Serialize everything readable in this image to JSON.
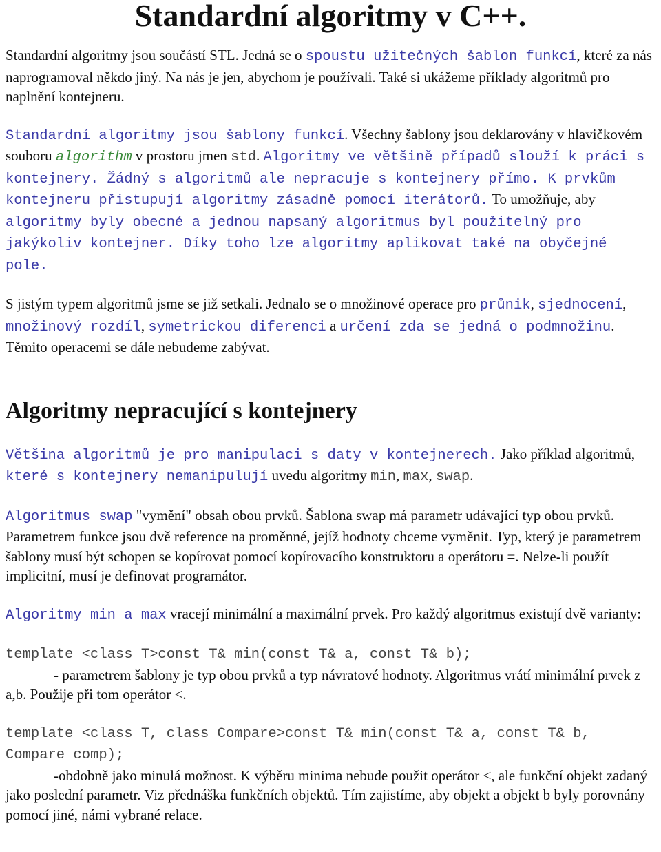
{
  "title": "Standardní algoritmy v C++.",
  "heading2": "Algoritmy nepracující s kontejnery",
  "paragraphs": [
    {
      "id": "intro",
      "cls": "",
      "segs": [
        {
          "t": "Standardní algoritmy jsou součástí STL. Jedná se o ",
          "s": "text"
        },
        {
          "t": "spoustu užitečných šablon funkcí",
          "s": "blue"
        },
        {
          "t": ", které za nás naprogramoval někdo jiný. Na nás je jen, abychom je používali. Také si ukážeme příklady algoritmů pro naplnění kontejneru.",
          "s": "text"
        }
      ]
    },
    {
      "id": "templates",
      "cls": "",
      "segs": [
        {
          "t": "Standardní algoritmy jsou šablony funkcí",
          "s": "blue"
        },
        {
          "t": ". Všechny šablony jsou deklarovány v hlavičkovém souboru ",
          "s": "text"
        },
        {
          "t": "algorithm",
          "s": "green"
        },
        {
          "t": " v prostoru jmen ",
          "s": "text"
        },
        {
          "t": "std",
          "s": "gray"
        },
        {
          "t": ". ",
          "s": "text"
        },
        {
          "t": "Algoritmy ve většině případů slouží k práci s kontejnery. Žádný s algoritmů ale nepracuje s kontejnery přímo. K prvkům kontejneru přistupují algoritmy zásadně pomocí iterátorů.",
          "s": "blue"
        },
        {
          "t": " To umožňuje, aby ",
          "s": "text"
        },
        {
          "t": "algoritmy byly obecné a jednou napsaný algoritmus byl použitelný pro jakýkoliv kontejner. Díky toho lze algoritmy aplikovat také na obyčejné pole.",
          "s": "blue"
        }
      ]
    },
    {
      "id": "sets",
      "cls": "",
      "segs": [
        {
          "t": "S jistým typem algoritmů jsme se již setkali. Jednalo se o množinové operace pro ",
          "s": "text"
        },
        {
          "t": "průnik",
          "s": "blue"
        },
        {
          "t": ", ",
          "s": "text"
        },
        {
          "t": "sjednocení",
          "s": "blue"
        },
        {
          "t": ", ",
          "s": "text"
        },
        {
          "t": "množinový rozdíl",
          "s": "blue"
        },
        {
          "t": ", ",
          "s": "text"
        },
        {
          "t": "symetrickou diferenci",
          "s": "blue"
        },
        {
          "t": " a ",
          "s": "text"
        },
        {
          "t": "určení zda se jedná o podmnožinu",
          "s": "blue"
        },
        {
          "t": ". Těmito operacemi se dále nebudeme zabývat.",
          "s": "text"
        }
      ]
    },
    {
      "id": "h2",
      "heading": true
    },
    {
      "id": "most",
      "cls": "",
      "segs": [
        {
          "t": "Většina algoritmů je pro manipulaci s daty v kontejnerech.",
          "s": "blue"
        },
        {
          "t": " Jako příklad algoritmů, ",
          "s": "text"
        },
        {
          "t": "které s kontejnery nemanipulují",
          "s": "blue"
        },
        {
          "t": " uvedu algoritmy ",
          "s": "text"
        },
        {
          "t": "min",
          "s": "gray"
        },
        {
          "t": ", ",
          "s": "text"
        },
        {
          "t": "max",
          "s": "gray"
        },
        {
          "t": ", ",
          "s": "text"
        },
        {
          "t": "swap",
          "s": "gray"
        },
        {
          "t": ".",
          "s": "text"
        }
      ]
    },
    {
      "id": "swap",
      "cls": "",
      "segs": [
        {
          "t": "Algoritmus swap",
          "s": "blue"
        },
        {
          "t": " \"vymění\" obsah obou prvků. Šablona swap má parametr udávající typ obou prvků. Parametrem funkce jsou dvě reference na proměnné, jejíž hodnoty chceme vyměnit. Typ, který je parametrem šablony musí být schopen se kopírovat pomocí kopírovacího konstruktoru a operátoru =. Nelze-li použít implicitní, musí je definovat programátor.",
          "s": "text"
        }
      ]
    },
    {
      "id": "minmax",
      "cls": "",
      "segs": [
        {
          "t": "Algoritmy min a max",
          "s": "blue"
        },
        {
          "t": " vracejí minimální a maximální prvek. Pro každý algoritmus existují dvě varianty:",
          "s": "text"
        }
      ]
    },
    {
      "id": "code1",
      "cls": "",
      "segs": [
        {
          "t": "template <class T>const T& min(const T& a, const T& b);",
          "s": "gray"
        }
      ]
    },
    {
      "id": "desc1",
      "cls": "indent after-code",
      "segs": [
        {
          "t": "- parametrem šablony je typ obou prvků a typ návratové hodnoty. Algoritmus vrátí minimální prvek z a,b. Použije při tom operátor <.",
          "s": "text"
        }
      ]
    },
    {
      "id": "code2",
      "cls": "",
      "segs": [
        {
          "t": "template <class T, class Compare>const T& min(const T& a, const T& b, Compare comp);",
          "s": "gray"
        }
      ]
    },
    {
      "id": "desc2",
      "cls": "indent after-code",
      "segs": [
        {
          "t": "-obdobně jako minulá možnost. K výběru minima nebude použit operátor <, ale funkční objekt zadaný jako poslední parametr. Viz přednáška funkčních objektů. Tím zajistíme, aby objekt a objekt b byly porovnány pomocí jiné, námi vybrané relace.",
          "s": "text"
        }
      ]
    }
  ],
  "colors": {
    "code_blue": "#3a3aa8",
    "code_green": "#3a8a3a",
    "code_gray": "#444444"
  }
}
